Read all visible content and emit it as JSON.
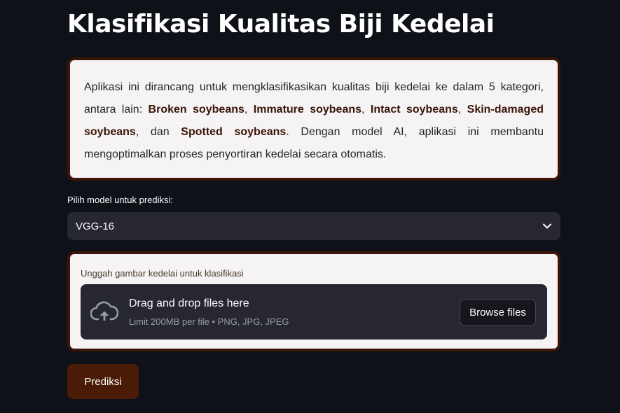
{
  "page": {
    "title": "Klasifikasi Kualitas Biji Kedelai"
  },
  "description": {
    "intro": "Aplikasi ini dirancang untuk mengklasifikasikan kualitas biji kedelai ke dalam 5 kategori, antara lain: ",
    "category_1": "Broken soybeans",
    "sep_1": ", ",
    "category_2": "Immature soybeans",
    "sep_2": ", ",
    "category_3": "Intact soybeans",
    "sep_3": ", ",
    "category_4": "Skin-damaged soybeans",
    "sep_4": ", dan ",
    "category_5": "Spotted soybeans",
    "outro": ". Dengan model AI, aplikasi ini membantu mengoptimalkan proses penyortiran kedelai secara otomatis."
  },
  "model_select": {
    "label": "Pilih model untuk prediksi:",
    "value": "VGG-16",
    "icon": "chevron-down-icon"
  },
  "uploader": {
    "label": "Unggah gambar kedelai untuk klasifikasi",
    "drop_title": "Drag and drop files here",
    "drop_subtitle": "Limit 200MB per file • PNG, JPG, JPEG",
    "browse_label": "Browse files",
    "icon": "cloud-upload-icon"
  },
  "predict_button": {
    "label": "Prediksi"
  },
  "colors": {
    "background": "#0e1117",
    "accent": "#4a1b06",
    "card_border": "#3a1508",
    "card_bg": "#f5f3f3",
    "widget_bg": "#262730"
  }
}
